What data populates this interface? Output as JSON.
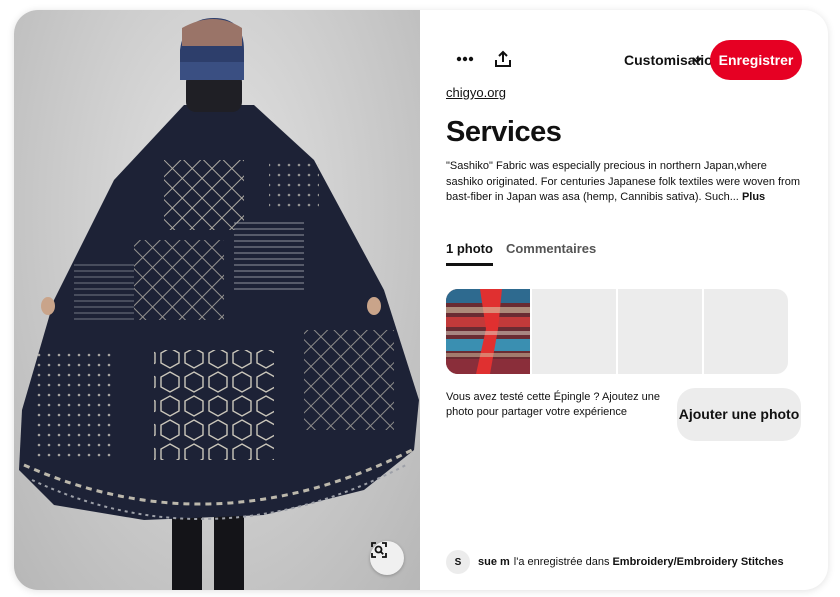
{
  "pin": {
    "source_link": "chigyo.org",
    "title": "Services",
    "description": "\"Sashiko\" Fabric was especially precious in northern Japan,where sashiko originated. For centuries Japanese folk textiles were woven from bast-fiber in Japan was asa (hemp, Cannibis sativa). Such...",
    "more_label": "Plus"
  },
  "toolbar": {
    "more_icon": "more-icon",
    "share_icon": "share-icon",
    "customize_label": "Customisation",
    "save_label": "Enregistrer",
    "save_color": "#e60023"
  },
  "tabs": [
    {
      "label": "1 photo",
      "active": true
    },
    {
      "label": "Commentaires",
      "active": false
    }
  ],
  "tried": {
    "text": "Vous avez testé cette Épingle ? Ajoutez une photo pour partager votre expérience",
    "button_label": "Ajouter une photo"
  },
  "footer": {
    "avatar_initial": "S",
    "user_name": "sue m",
    "saved_text": "l'a enregistrée dans",
    "board_name": "Embroidery/Embroidery Stitches"
  },
  "icons": {
    "lens": "visual-search-icon",
    "chevron": "chevron-down-icon"
  }
}
